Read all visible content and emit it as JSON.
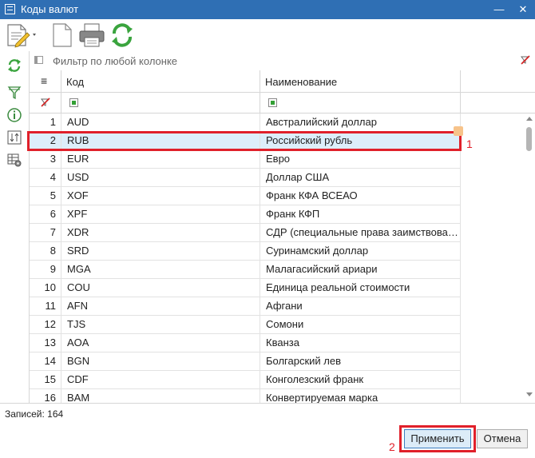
{
  "window": {
    "title": "Коды валют",
    "minimize": "—",
    "close": "✕"
  },
  "toolbar": {
    "items": [
      {
        "name": "edit-document-icon",
        "has_dropdown": true
      },
      {
        "name": "new-document-icon"
      },
      {
        "name": "print-icon"
      },
      {
        "name": "refresh-icon"
      }
    ]
  },
  "sidebar": {
    "items": [
      "refresh-icon",
      "filter-icon",
      "info-icon",
      "sort-icon",
      "table-settings-icon"
    ]
  },
  "filter": {
    "placeholder": "Фильтр по любой колонке"
  },
  "table": {
    "columns": {
      "number_icon": "≡",
      "code": "Код",
      "name": "Наименование"
    },
    "rows": [
      {
        "n": "1",
        "code": "AUD",
        "name": "Австралийский доллар"
      },
      {
        "n": "2",
        "code": "RUB",
        "name": "Российский рубль",
        "selected": true
      },
      {
        "n": "3",
        "code": "EUR",
        "name": "Евро"
      },
      {
        "n": "4",
        "code": "USD",
        "name": "Доллар США"
      },
      {
        "n": "5",
        "code": "XOF",
        "name": "Франк КФА ВСЕАО"
      },
      {
        "n": "6",
        "code": "XPF",
        "name": "Франк КФП"
      },
      {
        "n": "7",
        "code": "XDR",
        "name": "СДР (специальные права заимствования)"
      },
      {
        "n": "8",
        "code": "SRD",
        "name": "Суринамский доллар"
      },
      {
        "n": "9",
        "code": "MGA",
        "name": "Малагасийский ариари"
      },
      {
        "n": "10",
        "code": "COU",
        "name": "Единица реальной стоимости"
      },
      {
        "n": "11",
        "code": "AFN",
        "name": "Афгани"
      },
      {
        "n": "12",
        "code": "TJS",
        "name": "Сомони"
      },
      {
        "n": "13",
        "code": "AOA",
        "name": "Кванза"
      },
      {
        "n": "14",
        "code": "BGN",
        "name": "Болгарский лев"
      },
      {
        "n": "15",
        "code": "CDF",
        "name": "Конголезский франк"
      },
      {
        "n": "16",
        "code": "BAM",
        "name": "Конвертируемая марка"
      }
    ]
  },
  "annotations": {
    "marker_1": "1",
    "marker_2": "2"
  },
  "footer": {
    "records": "Записей: 164",
    "apply": "Применить",
    "cancel": "Отмена"
  },
  "colors": {
    "title_bar": "#2f6fb4",
    "highlight": "#e0202a",
    "selection": "#ddeefa"
  }
}
